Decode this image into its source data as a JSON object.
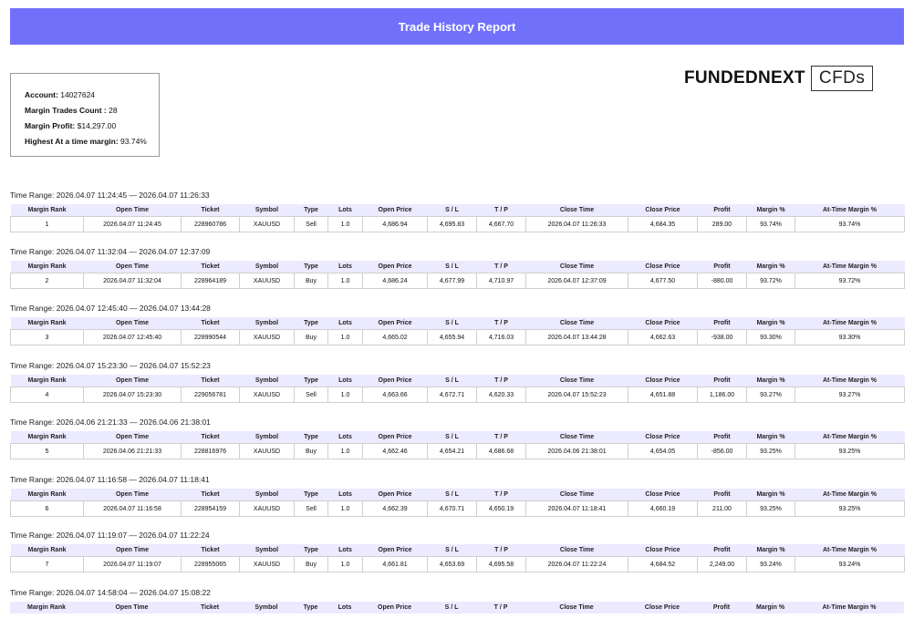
{
  "header": {
    "title": "Trade History Report"
  },
  "logo": {
    "main": "FUNDEDNEXT",
    "suffix": "CFDs"
  },
  "account": {
    "account_label": "Account:",
    "account_value": "14027624",
    "count_label": "Margin Trades Count :",
    "count_value": "28",
    "profit_label": "Margin Profit:",
    "profit_value": "$14,297.00",
    "highest_label": "Highest At a time margin:",
    "highest_value": "93.74%"
  },
  "columns": [
    "Margin Rank",
    "Open Time",
    "Ticket",
    "Symbol",
    "Type",
    "Lots",
    "Open Price",
    "S / L",
    "T / P",
    "Close Time",
    "Close Price",
    "Profit",
    "Margin %",
    "At-Time Margin %"
  ],
  "sections": [
    {
      "range": "Time Range: 2026.04.07 11:24:45 — 2026.04.07 11:26:33",
      "row": [
        "1",
        "2026.04.07 11:24:45",
        "228960786",
        "XAUUSD",
        "Sell",
        "1.0",
        "4,686.94",
        "4,695.83",
        "4,667.70",
        "2026.04.07 11:26:33",
        "4,684.35",
        "289.00",
        "93.74%",
        "93.74%"
      ]
    },
    {
      "range": "Time Range: 2026.04.07 11:32:04 — 2026.04.07 12:37:09",
      "row": [
        "2",
        "2026.04.07 11:32:04",
        "228964189",
        "XAUUSD",
        "Buy",
        "1.0",
        "4,686.24",
        "4,677.99",
        "4,710.97",
        "2026.04.07 12:37:09",
        "4,677.50",
        "-880.00",
        "93.72%",
        "93.72%"
      ]
    },
    {
      "range": "Time Range: 2026.04.07 12:45:40 — 2026.04.07 13:44:28",
      "row": [
        "3",
        "2026.04.07 12:45:40",
        "228990544",
        "XAUUSD",
        "Buy",
        "1.0",
        "4,665.02",
        "4,655.94",
        "4,716.03",
        "2026.04.07 13:44:28",
        "4,662.63",
        "-938.00",
        "93.30%",
        "93.30%"
      ]
    },
    {
      "range": "Time Range: 2026.04.07 15:23:30 — 2026.04.07 15:52:23",
      "row": [
        "4",
        "2026.04.07 15:23:30",
        "229056781",
        "XAUUSD",
        "Sell",
        "1.0",
        "4,663.66",
        "4,672.71",
        "4,620.33",
        "2026.04.07 15:52:23",
        "4,651.88",
        "1,186.00",
        "93.27%",
        "93.27%"
      ]
    },
    {
      "range": "Time Range: 2026.04.06 21:21:33 — 2026.04.06 21:38:01",
      "row": [
        "5",
        "2026.04.06 21:21:33",
        "228816976",
        "XAUUSD",
        "Buy",
        "1.0",
        "4,662.46",
        "4,654.21",
        "4,686.68",
        "2026.04.06 21:38:01",
        "4,654.05",
        "-856.00",
        "93.25%",
        "93.25%"
      ]
    },
    {
      "range": "Time Range: 2026.04.07 11:16:58 — 2026.04.07 11:18:41",
      "row": [
        "6",
        "2026.04.07 11:16:58",
        "228954159",
        "XAUUSD",
        "Sell",
        "1.0",
        "4,662.39",
        "4,670.71",
        "4,650.19",
        "2026.04.07 11:18:41",
        "4,660.19",
        "211.00",
        "93.25%",
        "93.25%"
      ]
    },
    {
      "range": "Time Range: 2026.04.07 11:19:07 — 2026.04.07 11:22:24",
      "row": [
        "7",
        "2026.04.07 11:19:07",
        "228955065",
        "XAUUSD",
        "Buy",
        "1.0",
        "4,661.81",
        "4,653.69",
        "4,695.58",
        "2026.04.07 11:22:24",
        "4,684.52",
        "2,249.00",
        "93.24%",
        "93.24%"
      ]
    },
    {
      "range": "Time Range: 2026.04.07 14:58:04 — 2026.04.07 15:08:22",
      "row": null
    }
  ]
}
